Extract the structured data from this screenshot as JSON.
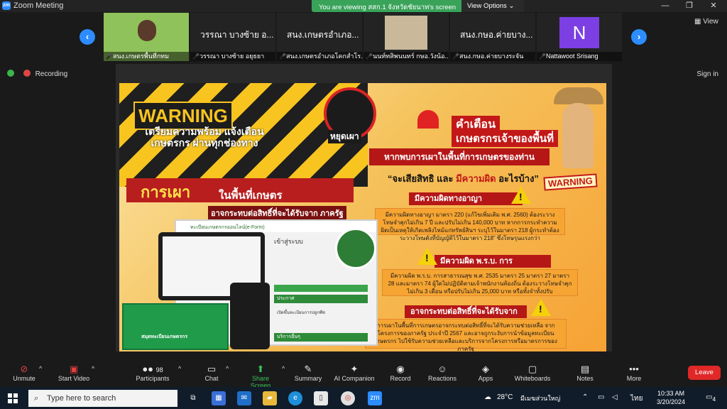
{
  "window": {
    "title": "Zoom Meeting",
    "icon_text": "zm",
    "minimize": "—",
    "restore": "❐",
    "close": "✕"
  },
  "share_banner": {
    "text": "You are viewing สสก.1 จังหวัดชัยนาท's screen",
    "view_options": "View Options ⌄"
  },
  "participants_strip": {
    "tiles": [
      {
        "label": "สนง.เกษตรพื้นที่กทม",
        "name": ""
      },
      {
        "label": "วรรณา บางซ้าย อยุธยา",
        "name": "วรรณา บางซ้าย อ..."
      },
      {
        "label": "สนง.เกษตรอำเภอโคกสำโร...",
        "name": "สนง.เกษตรอำเภอ..."
      },
      {
        "label": "นนท์ทสิพนนทร์ กษอ.วังน้อ...",
        "name": ""
      },
      {
        "label": "สนง.กษอ.ค่ายบางระจัน",
        "name": "สนง.กษอ.ค่ายบาง..."
      },
      {
        "label": "Nattawoot Srisang",
        "name": "N"
      }
    ],
    "prev": "‹",
    "next": "›",
    "view_label": "View",
    "mic_icon": "🎤"
  },
  "status": {
    "recording": "Recording",
    "sign_in": "Sign in"
  },
  "poster": {
    "warning": "WARNING",
    "prepare": "เตรียมความพร้อม แจ้งเตือนเกษตรกร ผ่านทุกช่องทาง",
    "burning": "การเผา",
    "in_area": "ในพื้นที่เกษตร",
    "rights": "อาจกระทบต่อสิทธิ์ที่จะได้รับจาก ภาครัฐ",
    "stop_burn": "หยุดเผา",
    "caution": "คำเตือน",
    "owner": "เกษตรกรเจ้าของพื้นที่",
    "found": "หากพบการเผาในพื้นที่การเกษตรของท่าน",
    "lose_a": "“จะเสียสิทธิ และ ",
    "lose_b": "มีความผิด",
    "lose_c": " อะไรบ้าง”",
    "warning2": "WARNING",
    "sections": [
      {
        "title": "มีความผิดทางอาญา",
        "body": "มีความผิดทางอาญา มาตรา 220 (แก้ไขเพิ่มเติม พ.ศ. 2560) ต้องระวางโทษจำคุกไม่เกิน 7 ปี และปรับไม่เกิน 140,000 บาท หากการกระทำความผิดเป็นเหตุให้เกิดเพลิงไหม้แก่ทรัพย์สินฯ ระบุไว้ในมาตรา 218 ผู้กระทำต้องระวางโทษดังที่บัญญัติไว้ในมาตรา 218” ซึ่งโทษรุนแรงกว่า"
      },
      {
        "title": "มีความผิด พ.ร.บ. การสาธารณสุข",
        "body": "มีความผิด พ.ร.บ. การสาธารณสุข พ.ศ. 2535 มาตรา 25 มาตรา 27 มาตรา 28 และมาตรา 74 ผู้ใดไม่ปฏิบัติตามเจ้าพนักงานท้องถิ่น ต้องระวางโทษจำคุกไม่เกิน 3 เดือน หรือปรับไม่เกิน 25,000 บาท หรือทั้งจำทั้งปรับ"
      },
      {
        "title": "อาจกระทบต่อสิทธิ์ที่จะได้รับจากภาครัฐ",
        "body": "การเผาในพื้นที่การเกษตรอาจกระทบต่อสิทธิ์ที่จะได้รับความช่วยเหลือ จากโครงการของภาครัฐ ประจำปี 2567 และอาจถูกระงับการนำข้อมูลทะเบียนเกษตรกร ไปใช้รับความช่วยเหลือและบริการจากโครงการหรือมาตรการของภาครัฐ"
      }
    ],
    "pc": {
      "topbar": "ทะเบียนเกษตรกรออนไลน์(e-Form)",
      "login": "เข้าสู่ระบบ",
      "announce": "ประกาศ",
      "announce_item": "เปิดขึ้นทะเบียนการปลูกพืช",
      "services": "บริการอื่นๆ",
      "book": "สมุดทะเบียนเกษตรกร"
    }
  },
  "toolbar": {
    "unmute": "Unmute",
    "start_video": "Start Video",
    "participants": "Participants",
    "participants_count": "98",
    "chat": "Chat",
    "share": "Share Screen",
    "summary": "Summary",
    "ai": "AI Companion",
    "record": "Record",
    "reactions": "Reactions",
    "apps": "Apps",
    "whiteboards": "Whiteboards",
    "notes": "Notes",
    "more": "More",
    "leave": "Leave",
    "caret": "^"
  },
  "taskbar": {
    "search": "Type here to search",
    "weather_temp": "28°C",
    "weather_text": "มีเมฆส่วนใหญ่",
    "lang": "ไทย",
    "time": "10:33 AM",
    "date": "3/20/2024",
    "notif": "4"
  },
  "colors": {
    "accent": "#2d8cff",
    "leave": "#e02828",
    "share_banner": "#39a35a",
    "poster_red": "#b51717"
  }
}
